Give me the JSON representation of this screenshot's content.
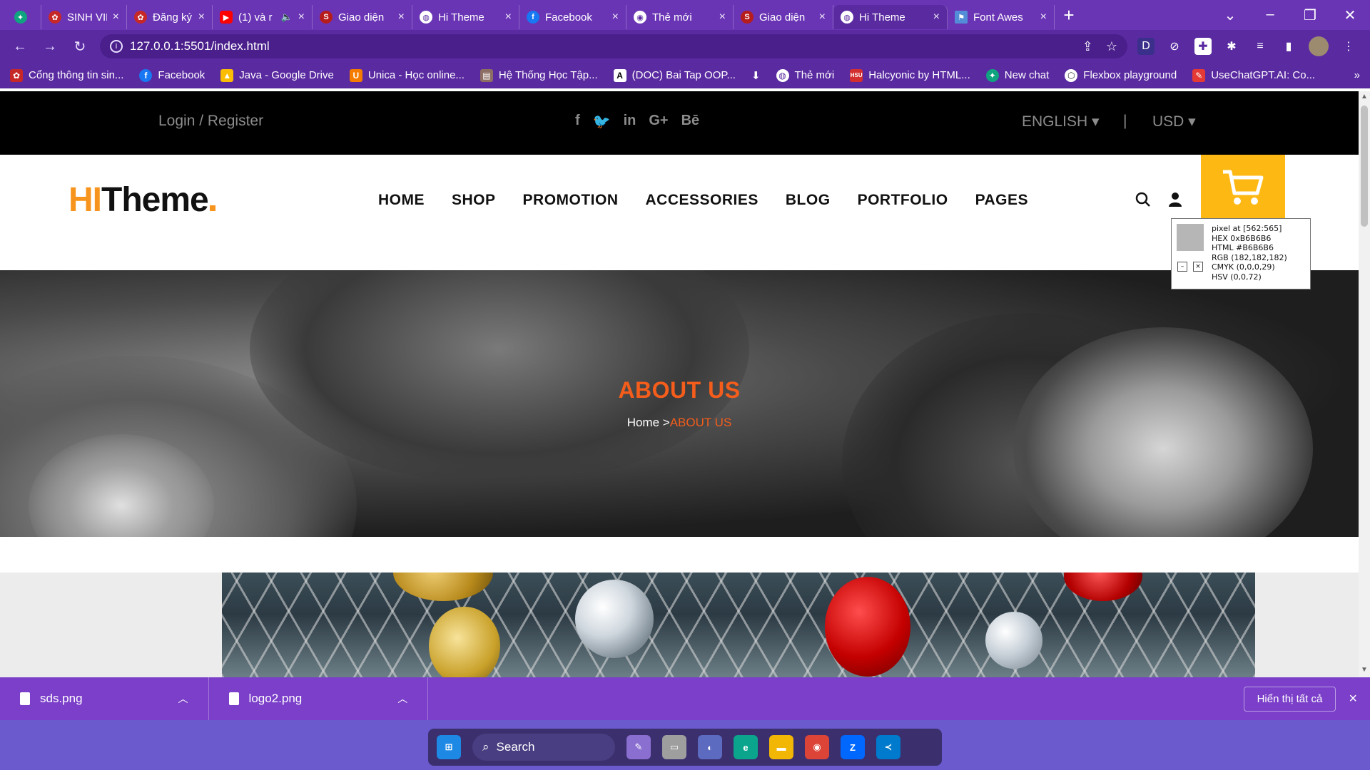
{
  "browser": {
    "tabs": [
      {
        "label": "",
        "icon": "chatgpt-icon",
        "color": "#10a37f"
      },
      {
        "label": "SINH VIÊN",
        "icon": "university-icon",
        "color": "#c62828"
      },
      {
        "label": "Đăng ký h",
        "icon": "university-icon",
        "color": "#c62828"
      },
      {
        "label": "(1) và r",
        "icon": "youtube-icon",
        "color": "#ff0000"
      },
      {
        "label": "Giao diện",
        "icon": "s-logo-icon",
        "color": "#b71c1c"
      },
      {
        "label": "Hi Theme",
        "icon": "globe-icon",
        "color": "#ffffff"
      },
      {
        "label": "Facebook",
        "icon": "facebook-icon",
        "color": "#1877f2"
      },
      {
        "label": "Thẻ mới",
        "icon": "chrome-icon",
        "color": "#ffffff"
      },
      {
        "label": "Giao diện",
        "icon": "s-logo-icon",
        "color": "#b71c1c"
      },
      {
        "label": "Hi Theme",
        "icon": "globe-icon",
        "color": "#ffffff",
        "active": true
      },
      {
        "label": "Font Awes",
        "icon": "flag-icon",
        "color": "#538dd7"
      }
    ],
    "new_tab": "+",
    "url": "127.0.0.1:5501/index.html",
    "bookmarks": [
      {
        "label": "Cổng thông tin sin...",
        "color": "#c62828"
      },
      {
        "label": "Facebook",
        "color": "#1877f2"
      },
      {
        "label": "Java - Google Drive",
        "color": "#fbbc04"
      },
      {
        "label": "Unica - Học online...",
        "color": "#f57c00"
      },
      {
        "label": "Hệ Thống Học Tập...",
        "color": "#8d6e63"
      },
      {
        "label": "(DOC) Bai Tap OOP...",
        "color": "#222222"
      },
      {
        "label": "",
        "color": "#ffffff"
      },
      {
        "label": "Thẻ mới",
        "color": "#ffffff"
      },
      {
        "label": "Halcyonic by HTML...",
        "color": "#d32f2f"
      },
      {
        "label": "New chat",
        "color": "#10a37f"
      },
      {
        "label": "Flexbox playground",
        "color": "#333333"
      },
      {
        "label": "UseChatGPT.AI: Co...",
        "color": "#e53935"
      }
    ],
    "more_bookmarks": "»"
  },
  "site": {
    "topbar": {
      "login": "Login / Register",
      "social": [
        "f",
        "t",
        "in",
        "G+",
        "Bē"
      ],
      "language": "ENGLISH ▾",
      "separator": "|",
      "currency": "USD ▾"
    },
    "logo": {
      "hi": "HI",
      "theme": "Theme"
    },
    "menu": [
      "HOME",
      "SHOP",
      "PROMOTION",
      "ACCESSORIES",
      "BLOG",
      "PORTFOLIO",
      "PAGES"
    ],
    "hero": {
      "title": "ABOUT US",
      "breadcrumb_home": "Home >",
      "breadcrumb_current": "ABOUT US"
    },
    "accent": "#f45d1b",
    "cart_color": "#fdb813"
  },
  "color_picker": {
    "lines": [
      "pixel at [562:565]",
      "HEX 0xB6B6B6",
      "HTML #B6B6B6",
      "RGB (182,182,182)",
      "CMYK (0,0,0,29)",
      "HSV (0,0,72)"
    ],
    "swatch": "#b6b6b6",
    "minimize": "–",
    "close": "×"
  },
  "downloads": {
    "items": [
      {
        "name": "sds.png"
      },
      {
        "name": "logo2.png"
      }
    ],
    "show_all": "Hiển thị tất cả",
    "close": "×"
  },
  "taskbar": {
    "search": "Search",
    "apps": [
      "start-icon",
      "files-icon",
      "monitor-icon",
      "meet-icon",
      "edge-icon",
      "folder-icon",
      "chrome-icon",
      "zalo-icon",
      "vscode-icon"
    ]
  }
}
